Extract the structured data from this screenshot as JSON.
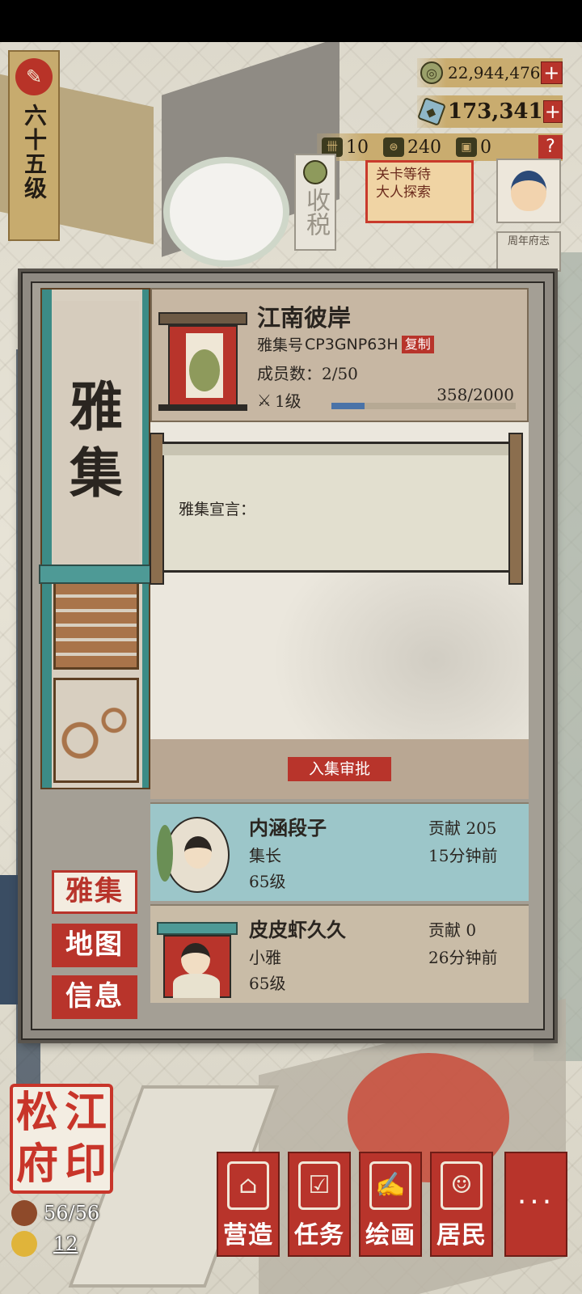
{
  "hud": {
    "level": "六十五级",
    "coins": "22,944,476",
    "gems": "173,341",
    "item1": "10",
    "item2": "240",
    "item3": "0",
    "plus": "+",
    "help": "?"
  },
  "map_labels": {
    "tax": "收税",
    "quest_lines": [
      "关卡等待",
      "大人探索"
    ],
    "annals": "周年府志"
  },
  "panel": {
    "side_title": "雅集",
    "tabs": [
      {
        "label": "雅集",
        "active": true
      },
      {
        "label": "地图",
        "active": false
      },
      {
        "label": "信息",
        "active": false
      }
    ],
    "guild": {
      "name": "江南彼岸",
      "id_label": "雅集号",
      "id_value": "CP3GNP63H",
      "copy_label": "复制",
      "members": "成员数：2/50",
      "level": "1级",
      "exp_text": "358/2000",
      "exp_progress": 0.179
    },
    "manifesto_label": "雅集宣言：",
    "approval_button": "入集审批",
    "members_list": [
      {
        "name": "内涵段子",
        "role": "集长",
        "level": "65级",
        "contribution": "贡献 205",
        "last_seen": "15分钟前"
      },
      {
        "name": "皮皮虾久久",
        "role": "小雅",
        "level": "65级",
        "contribution": "贡献 0",
        "last_seen": "26分钟前"
      }
    ]
  },
  "bottom": {
    "seal_chars": [
      "松",
      "江",
      "府",
      "印"
    ],
    "population": "56/56",
    "happiness": "12",
    "nav": [
      "营造",
      "任务",
      "绘画",
      "居民"
    ],
    "more": "···"
  },
  "colors": {
    "accent_red": "#b8342b",
    "teal": "#3c8b86",
    "gold": "#c9ac6f",
    "exp_bar": "#4a73a8"
  }
}
